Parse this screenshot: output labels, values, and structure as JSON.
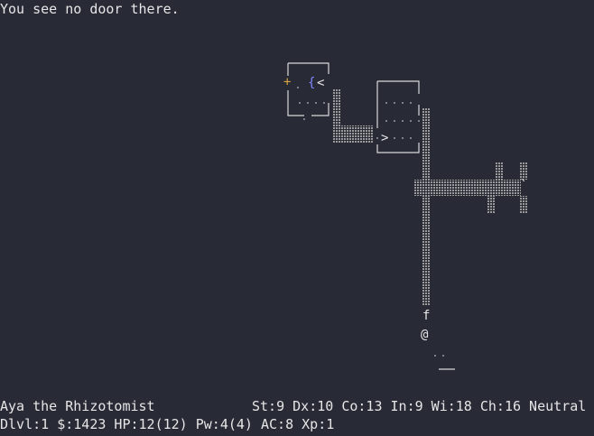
{
  "message": "You see no door there.",
  "status": {
    "name_title": "Aya the Rhizotomist",
    "stats": "St:9 Dx:10 Co:13 In:9 Wi:18 Ch:16 Neutral",
    "line2": "Dlvl:1 $:1423 HP:12(12) Pw:4(4) AC:8 Xp:1"
  },
  "map": {
    "player": "@",
    "pet": "f",
    "door": "+",
    "fountain": "{",
    "upstairs": "<",
    "downstairs": ">",
    "boulder": "`",
    "colors": {
      "background": "#282a36",
      "door": "#d9a441",
      "fountain": "#7f86ff",
      "text": "#e6e6e6",
      "corridor": "#9a9a9a"
    }
  }
}
